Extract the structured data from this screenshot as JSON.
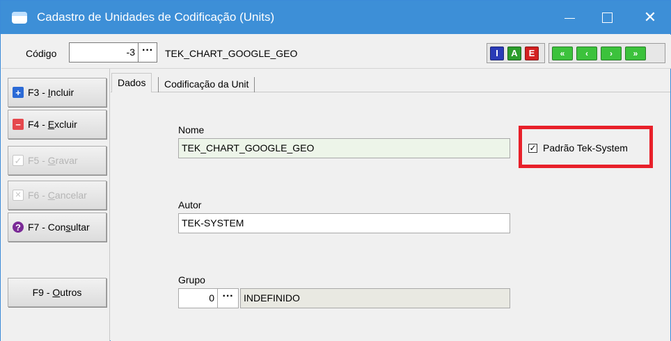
{
  "window": {
    "title": "Cadastro de Unidades de Codificação (Units)",
    "minimize_glyph": "—",
    "close_glyph": "✕"
  },
  "toolbar": {
    "codigo_label": "Código",
    "codigo_value": "-3",
    "codigo_button": "···",
    "codigo_name": "TEK_CHART_GOOGLE_GEO",
    "mode_buttons": [
      {
        "label": "I",
        "color": "#2a3bb7",
        "icon": "insert-mode-icon"
      },
      {
        "label": "A",
        "color": "#2c9d2c",
        "icon": "alter-mode-icon"
      },
      {
        "label": "E",
        "color": "#d32121",
        "icon": "delete-mode-icon"
      }
    ],
    "nav_buttons": [
      {
        "label": "«",
        "icon": "first-record-icon"
      },
      {
        "label": "‹",
        "icon": "prev-record-icon"
      },
      {
        "label": "›",
        "icon": "next-record-icon"
      },
      {
        "label": "»",
        "icon": "last-record-icon"
      }
    ]
  },
  "actions": {
    "incluir": {
      "prefix": "F3 - ",
      "accel": "I",
      "rest": "ncluir"
    },
    "excluir": {
      "prefix": "F4 - ",
      "accel": "E",
      "rest": "xcluir"
    },
    "gravar": {
      "prefix": "F5 - ",
      "accel": "G",
      "rest": "ravar"
    },
    "cancelar": {
      "prefix": "F6 - ",
      "accel": "C",
      "rest": "ancelar"
    },
    "consultar": {
      "prefix": "F7 - Con",
      "accel": "s",
      "rest": "ultar"
    },
    "outros": {
      "prefix": "F9 - ",
      "accel": "O",
      "rest": "utros"
    }
  },
  "tabs": [
    {
      "label": "Dados"
    },
    {
      "label": "Codificação da Unit"
    }
  ],
  "form": {
    "nome_label": "Nome",
    "nome_value": "TEK_CHART_GOOGLE_GEO",
    "autor_label": "Autor",
    "autor_value": "TEK-SYSTEM",
    "grupo_label": "Grupo",
    "grupo_value": "0",
    "grupo_button": "···",
    "grupo_desc": "INDEFINIDO",
    "padrao_label": "Padrão Tek-System",
    "padrao_checked": true,
    "padrao_check_glyph": "✓"
  },
  "colors": {
    "titlebar": "#3d8fd7",
    "highlight": "#e8202a",
    "nome_bg": "#edf5e9"
  }
}
